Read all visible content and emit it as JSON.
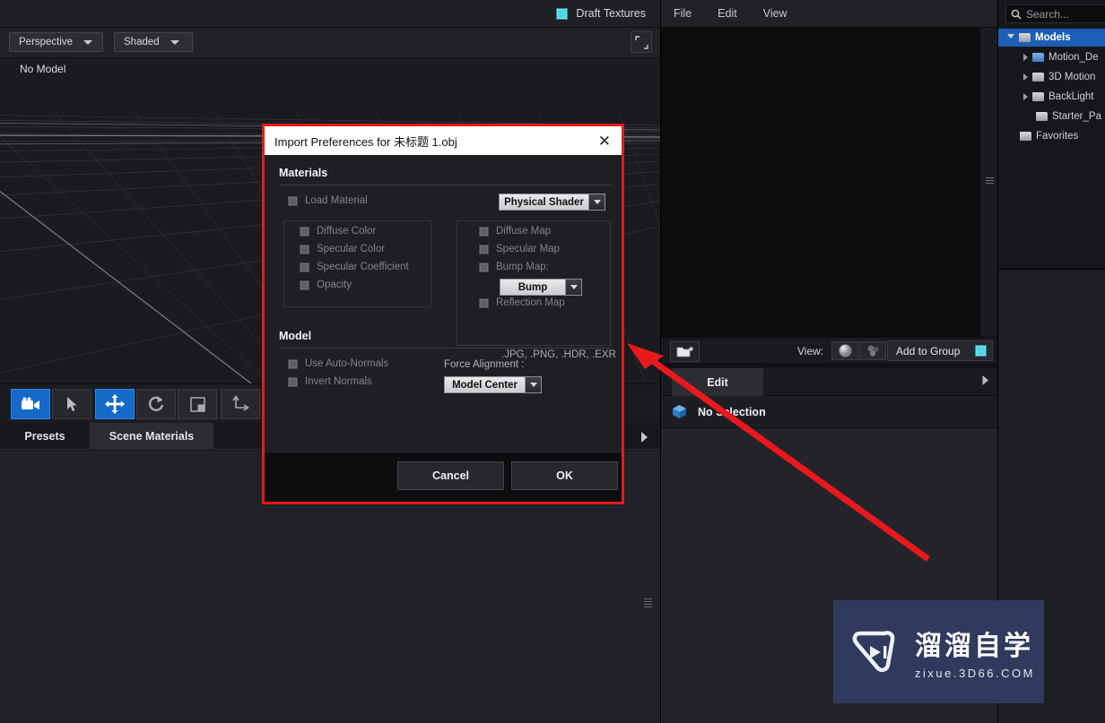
{
  "viewport": {
    "draft_textures_label": "Draft Textures",
    "camera_mode": "Perspective",
    "shading_mode": "Shaded",
    "status": "No Model",
    "expand_icon": "expand-icon",
    "tools": [
      {
        "name": "camera-tool",
        "icon": "video-camera-icon",
        "active": true
      },
      {
        "name": "select-tool",
        "icon": "cursor-arrow-icon",
        "active": false
      },
      {
        "name": "move-tool",
        "icon": "move-arrows-icon",
        "active": true
      },
      {
        "name": "rotate-tool",
        "icon": "rotate-arrow-icon",
        "active": false
      },
      {
        "name": "scale-tool",
        "icon": "scale-square-icon",
        "active": false
      },
      {
        "name": "axis-tool",
        "icon": "axis-transform-icon",
        "active": false
      }
    ]
  },
  "material_tabs": {
    "presets": "Presets",
    "scene_materials": "Scene Materials",
    "selected": "Scene Materials",
    "expand_icon": "chevron-right-icon"
  },
  "library": {
    "menu": [
      "File",
      "Edit",
      "View"
    ],
    "new_folder_icon": "new-folder-icon",
    "view_label": "View:",
    "view_modes": [
      {
        "name": "sphere-preview-icon",
        "selected": true
      },
      {
        "name": "cluster-preview-icon",
        "selected": false
      }
    ],
    "add_to_group_label": "Add to Group",
    "edit_tab_label": "Edit",
    "edit_expand_icon": "chevron-right-icon",
    "selection_label": "No Selection",
    "selection_icon": "cube-icon"
  },
  "browser": {
    "search_placeholder": "Search...",
    "search_icon": "search-icon",
    "tree": [
      {
        "label": "Models",
        "depth": 0,
        "expanded": true,
        "selected": true,
        "has_children": true,
        "folder": "white"
      },
      {
        "label": "Motion_De",
        "depth": 1,
        "expanded": false,
        "selected": false,
        "has_children": true,
        "folder": "blue"
      },
      {
        "label": "3D Motion",
        "depth": 1,
        "expanded": false,
        "selected": false,
        "has_children": true,
        "folder": "white"
      },
      {
        "label": "BackLight",
        "depth": 1,
        "expanded": false,
        "selected": false,
        "has_children": true,
        "folder": "white"
      },
      {
        "label": "Starter_Pa",
        "depth": 1,
        "expanded": false,
        "selected": false,
        "has_children": false,
        "folder": "white"
      },
      {
        "label": "Favorites",
        "depth": 0,
        "expanded": false,
        "selected": false,
        "has_children": false,
        "folder": "white"
      }
    ]
  },
  "dialog": {
    "title": "Import Preferences for 未标题 1.obj",
    "close_icon": "close-icon",
    "materials_header": "Materials",
    "load_material_label": "Load Material",
    "shader_dropdown": "Physical Shader",
    "color_options": [
      "Diffuse Color",
      "Specular Color",
      "Specular Coefficient",
      "Opacity"
    ],
    "map_options_top": [
      "Diffuse Map",
      "Specular Map",
      "Bump Map:"
    ],
    "bump_dropdown": "Bump",
    "map_options_bottom": [
      "Reflection Map"
    ],
    "format_note": ".JPG, .PNG, .HDR, .EXR",
    "model_header": "Model",
    "model_options": [
      "Use Auto-Normals",
      "Invert Normals"
    ],
    "force_alignment_label": "Force Alignment :",
    "alignment_dropdown": "Model Center",
    "cancel_label": "Cancel",
    "ok_label": "OK"
  },
  "annotation": {
    "color": "#e8191c",
    "arrow_name": "red-pointer-arrow",
    "highlight_name": "red-highlight-box"
  },
  "watermark": {
    "logo_icon": "play-button-logo-icon",
    "brand_cn": "溜溜自学",
    "brand_url": "zixue.3D66.COM",
    "bg_color": "#2f3a5c"
  }
}
